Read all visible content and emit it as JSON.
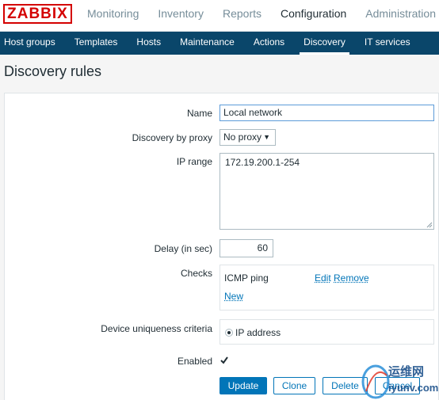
{
  "logo": "ZABBIX",
  "top_nav": [
    "Monitoring",
    "Inventory",
    "Reports",
    "Configuration",
    "Administration"
  ],
  "sub_nav": [
    "Host groups",
    "Templates",
    "Hosts",
    "Maintenance",
    "Actions",
    "Discovery",
    "IT services"
  ],
  "page_title": "Discovery rules",
  "form": {
    "name_label": "Name",
    "name_value": "Local network",
    "proxy_label": "Discovery by proxy",
    "proxy_value": "No proxy",
    "ip_range_label": "IP range",
    "ip_range_value": "172.19.200.1-254",
    "delay_label": "Delay (in sec)",
    "delay_value": "60",
    "checks_label": "Checks",
    "check_name": "ICMP ping",
    "edit_link": "Edit",
    "remove_link": "Remove",
    "new_link": "New",
    "uniqueness_label": "Device uniqueness criteria",
    "uniqueness_option": "IP address",
    "enabled_label": "Enabled",
    "enabled_checked": true
  },
  "buttons": {
    "update": "Update",
    "clone": "Clone",
    "delete": "Delete",
    "cancel": "Cancel"
  },
  "watermark": {
    "cn_text": "运维网",
    "url_text": "iyunv.com"
  }
}
